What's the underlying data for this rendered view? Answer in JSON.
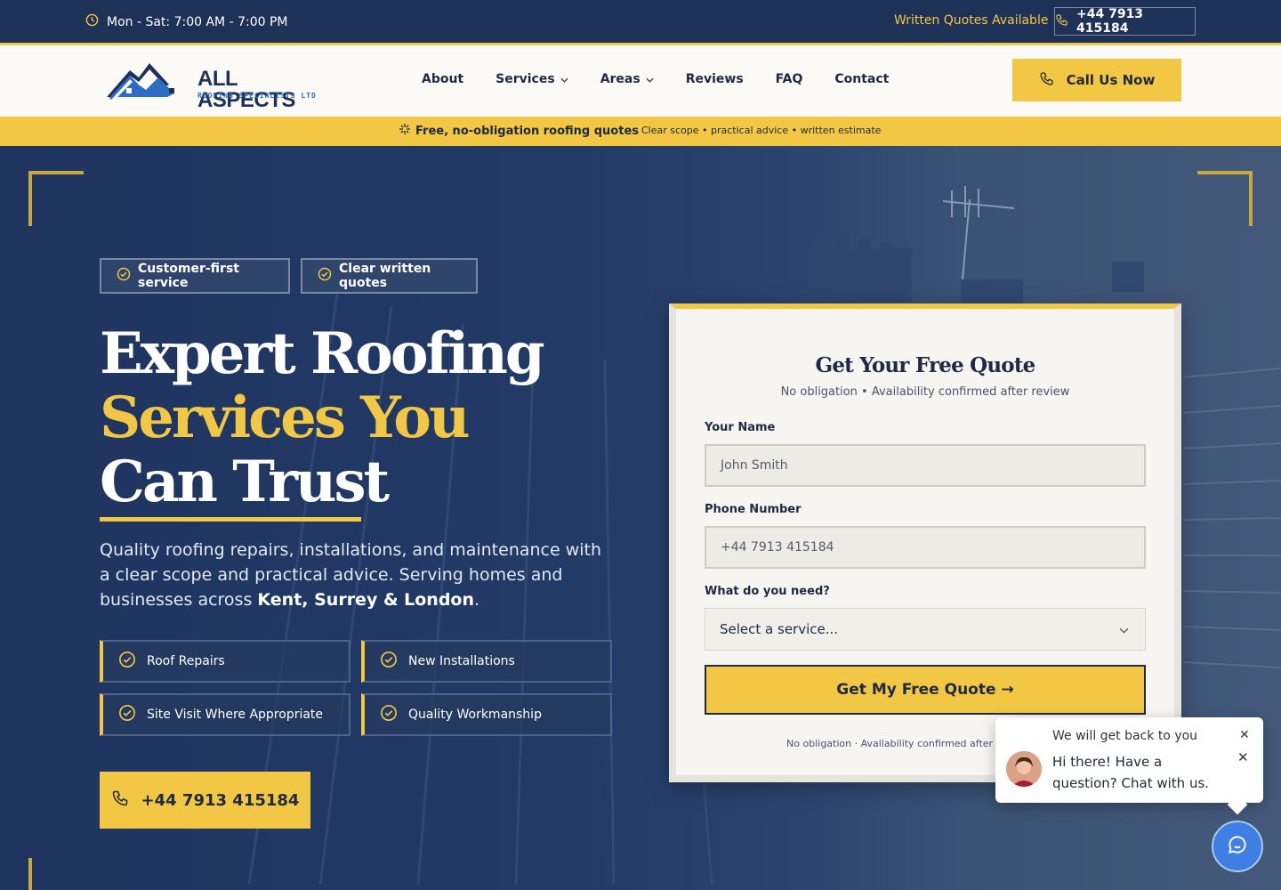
{
  "topbar": {
    "hours": "Mon - Sat: 7:00 AM - 7:00 PM",
    "written_quotes": "Written Quotes Available",
    "phone": "+44 7913 415184"
  },
  "logo": {
    "brand": "ALL ASPECTS",
    "tagline": "ROOFING SPECIALISTS LTD"
  },
  "nav": {
    "links": [
      {
        "label": "About",
        "dropdown": false
      },
      {
        "label": "Services",
        "dropdown": true
      },
      {
        "label": "Areas",
        "dropdown": true
      },
      {
        "label": "Reviews",
        "dropdown": false
      },
      {
        "label": "FAQ",
        "dropdown": false
      },
      {
        "label": "Contact",
        "dropdown": false
      }
    ],
    "cta": "Call Us Now"
  },
  "promo": {
    "main": "Free, no-obligation roofing quotes",
    "sub": "Clear scope • practical advice • written estimate"
  },
  "hero": {
    "chips": [
      "Customer-first service",
      "Clear written quotes"
    ],
    "headline_line1": "Expert Roofing",
    "headline_line2": "Services You",
    "headline_line3": "Can Trust",
    "lede_prefix": "Quality roofing repairs, installations, and maintenance with a clear scope and practical advice. Serving homes and businesses across ",
    "lede_strong": "Kent, Surrey & London",
    "lede_suffix": ".",
    "features": [
      "Roof Repairs",
      "New Installations",
      "Site Visit Where Appropriate",
      "Quality Workmanship"
    ],
    "phone_button": "+44 7913 415184"
  },
  "quote_form": {
    "title": "Get Your Free Quote",
    "subtitle": "No obligation • Availability confirmed after review",
    "name_label": "Your Name",
    "name_placeholder": "John Smith",
    "phone_label": "Phone Number",
    "phone_placeholder": "+44 7913 415184",
    "need_label": "What do you need?",
    "need_selected": "Select a service...",
    "submit": "Get My Free Quote →",
    "fine_print": "No obligation · Availability confirmed after review"
  },
  "chat": {
    "behind_text": "We will get back to you",
    "message": "Hi there! Have a question? Chat with us."
  },
  "colors": {
    "navy": "#1e3258",
    "yellow": "#f2c744",
    "chat_blue": "#3f7fe3"
  },
  "icons": [
    "clock-icon",
    "phone-icon",
    "chevron-down-icon",
    "sparkle-icon",
    "check-circle-icon",
    "chat-icon",
    "close-icon"
  ]
}
